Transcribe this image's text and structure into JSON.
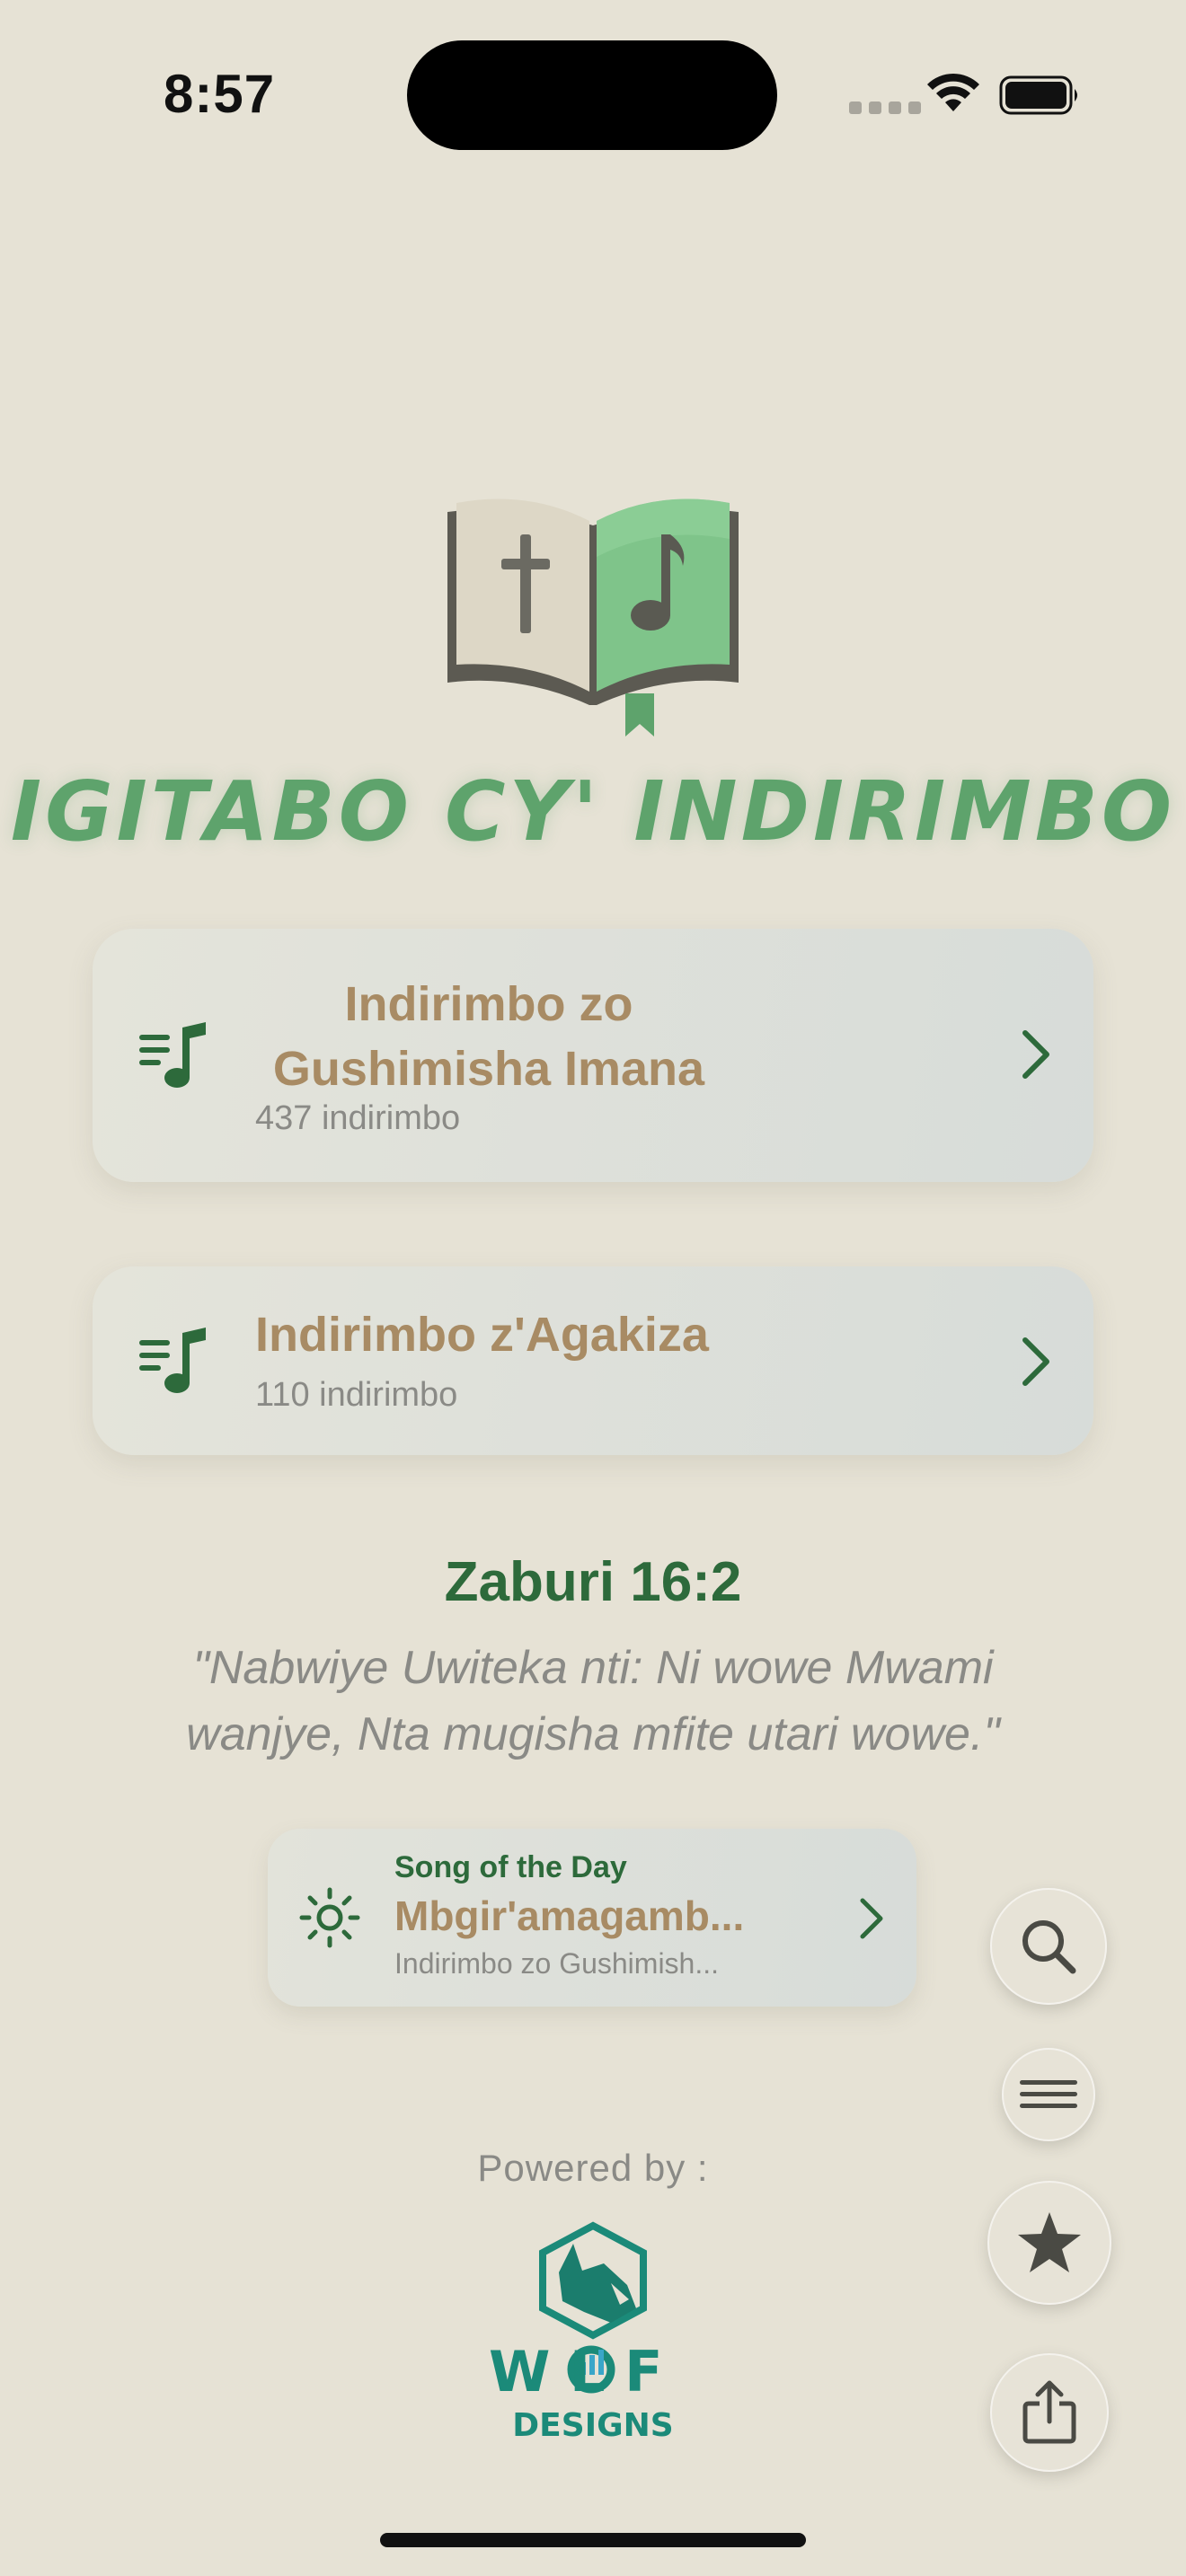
{
  "status_bar": {
    "time": "8:57"
  },
  "app": {
    "title": "IGITABO CY' INDIRIMBO"
  },
  "hymnals": [
    {
      "title": "Indirimbo zo Gushimisha Imana",
      "count_label": "437 indirimbo"
    },
    {
      "title": "Indirimbo z'Agakiza",
      "count_label": "110 indirimbo"
    }
  ],
  "verse": {
    "reference": "Zaburi 16:2",
    "text": "\"Nabwiye Uwiteka nti: Ni wowe Mwami wanjye, Nta mugisha mfite utari wowe.\""
  },
  "song_of_day": {
    "label": "Song of the Day",
    "title": "Mbgir'amagamb...",
    "source": "Indirimbo zo Gushimish..."
  },
  "footer": {
    "powered_by": "Powered by :",
    "brand_word": "W L F",
    "brand_sub": "DESIGNS"
  },
  "colors": {
    "background": "#e6e2d5",
    "title_green": "#5ea36c",
    "dark_green": "#2d6a3b",
    "tan": "#a88b64",
    "muted": "#8a8a86",
    "teal": "#1b8a79"
  },
  "icons": [
    "wifi-icon",
    "battery-icon",
    "bible-music-logo",
    "playlist-music-icon",
    "chevron-right-icon",
    "sun-icon",
    "search-icon",
    "menu-icon",
    "star-icon",
    "share-icon",
    "wolf-designs-logo"
  ]
}
